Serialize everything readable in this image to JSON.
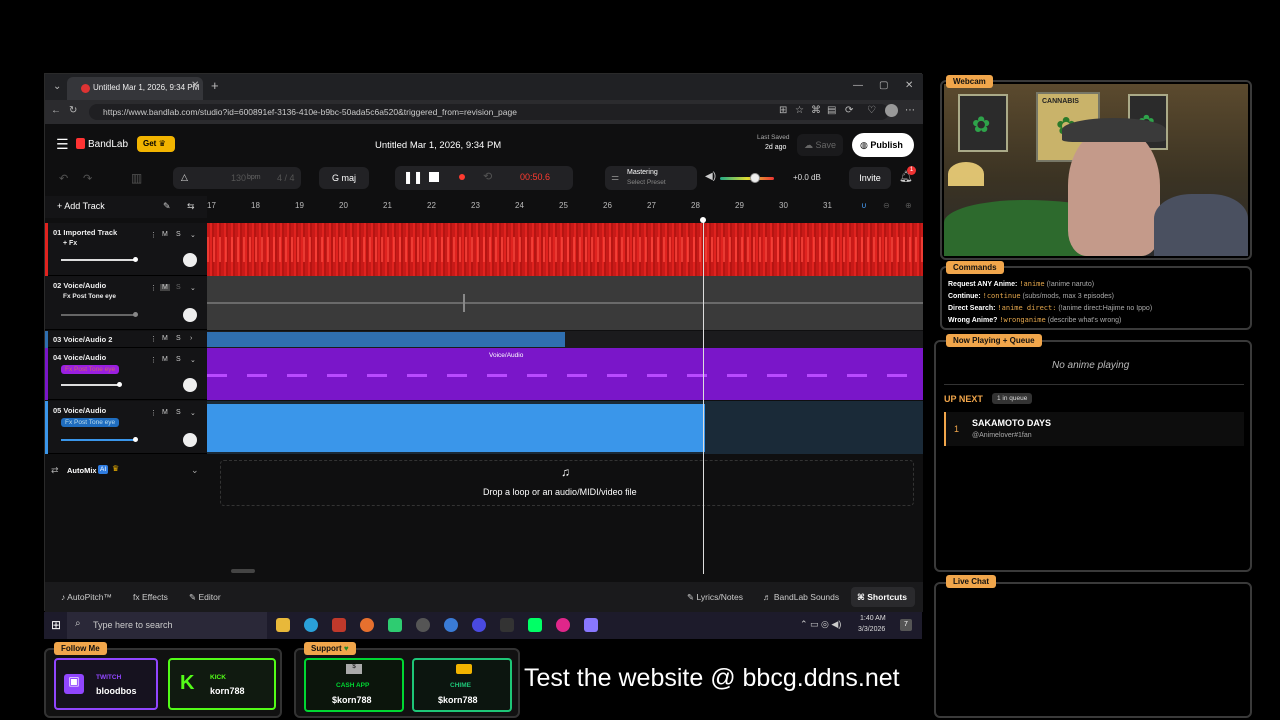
{
  "browser": {
    "tab_title": "Untitled Mar 1, 2026, 9:34 PM",
    "url": "https://www.bandlab.com/studio?id=600891ef-3136-410e-b9bc-50ada5c6a520&triggered_from=revision_page"
  },
  "bandlab": {
    "logo": "BandLab",
    "get_label": "Get",
    "project_title": "Untitled Mar 1, 2026, 9:34 PM",
    "last_saved_label": "Last Saved",
    "last_saved_value": "2d ago",
    "save_label": "Save",
    "publish_label": "Publish",
    "bpm": "130",
    "bpm_unit": "bpm",
    "time_sig": "4 / 4",
    "key": "G maj",
    "time": "00:50.6",
    "mastering_label": "Mastering",
    "mastering_preset": "Select Preset",
    "db": "+0.0 dB",
    "invite_label": "Invite",
    "notif_count": "1",
    "add_track_label": "Add Track",
    "ruler": [
      "17",
      "18",
      "19",
      "20",
      "21",
      "22",
      "23",
      "24",
      "25",
      "26",
      "27",
      "28",
      "29",
      "30",
      "31"
    ],
    "tracks": [
      {
        "name": "01  Imported Track",
        "fx": "+ Fx",
        "m": "M",
        "s": "S"
      },
      {
        "name": "02  Voice/Audio",
        "fx": "Fx Post Tone eye",
        "m": "M",
        "s": "S"
      },
      {
        "name": "03  Voice/Audio 2",
        "fx": "",
        "m": "M",
        "s": "S"
      },
      {
        "name": "04  Voice/Audio",
        "fx": "Fx Post Tone eye",
        "m": "M",
        "s": "S"
      },
      {
        "name": "05  Voice/Audio",
        "fx": "Fx Post Tone eye",
        "m": "M",
        "s": "S"
      }
    ],
    "clip_label": "Voice/Audio",
    "automix_label": "AutoMix",
    "ai_badge": "AI",
    "drop_text": "Drop a loop or an audio/MIDI/video file",
    "bottom": {
      "autopitch": "AutoPitch™",
      "effects": "Effects",
      "editor": "Editor",
      "lyrics": "Lyrics/Notes",
      "sounds": "BandLab Sounds",
      "shortcuts": "Shortcuts"
    }
  },
  "taskbar": {
    "search_placeholder": "Type here to search",
    "time": "1:40 AM",
    "date": "3/3/2026",
    "notif": "7"
  },
  "overlay": {
    "webcam_tag": "Webcam",
    "poster_text": "CANNABIS",
    "commands_tag": "Commands",
    "commands": [
      {
        "label": "Request ANY Anime:",
        "cmd": "!anime",
        "hint": "(!anime naruto)"
      },
      {
        "label": "Continue:",
        "cmd": "!continue",
        "hint": "(subs/mods, max 3 episodes)"
      },
      {
        "label": "Direct Search:",
        "cmd": "!anime direct:",
        "hint": "(!anime direct:Hajime no Ippo)"
      },
      {
        "label": "Wrong Anime?",
        "cmd": "!wronganime",
        "hint": "(describe what's wrong)"
      }
    ],
    "now_playing_tag": "Now Playing + Queue",
    "no_anime": "No anime playing",
    "up_next": "UP NEXT",
    "in_queue": "1 in queue",
    "queue": [
      {
        "num": "1",
        "title": "SAKAMOTO DAYS",
        "user": "@Animelover#1fan"
      }
    ],
    "live_chat_tag": "Live Chat",
    "follow_tag": "Follow Me",
    "twitch_label": "TWITCH",
    "twitch_user": "bloodbos",
    "kick_label": "KICK",
    "kick_user": "korn788",
    "support_tag": "Support",
    "cashapp_label": "CASH APP",
    "cashapp_user": "$korn788",
    "chime_label": "CHIME",
    "chime_user": "$korn788",
    "website_text": "Test the website @ bbcg.ddns.net"
  },
  "colors": {
    "track1": "#e0231f",
    "track2": "#3a3a3a",
    "track3": "#2f6fb0",
    "track4": "#7a16c9",
    "track5": "#3a96ea",
    "accent": "#f1a64b",
    "rec": "#ff3b30"
  }
}
